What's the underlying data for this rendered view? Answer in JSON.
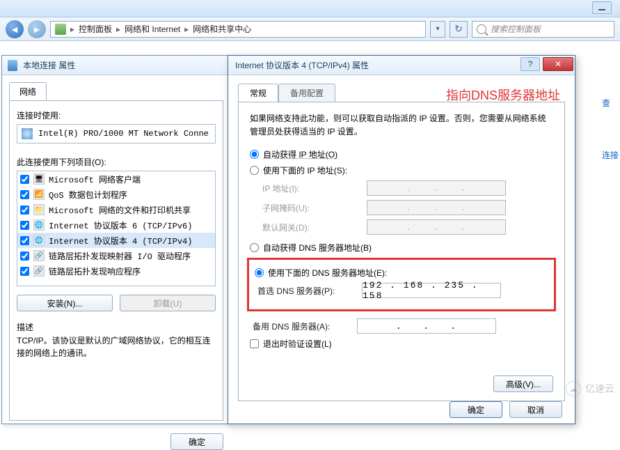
{
  "chrome": {
    "breadcrumbs": [
      "",
      "控制面板",
      "网络和 Internet",
      "网络和共享中心"
    ],
    "search_placeholder": "搜索控制面板"
  },
  "side_links": {
    "view": "查",
    "connect": "连接"
  },
  "dlg1": {
    "title": "本地连接 属性",
    "tab": "网络",
    "connect_label": "连接时使用:",
    "adapter": "Intel(R) PRO/1000 MT Network Conne",
    "items_label": "此连接使用下列项目(O):",
    "items": [
      {
        "label": "Microsoft 网络客户端",
        "checked": true
      },
      {
        "label": "QoS 数据包计划程序",
        "checked": true
      },
      {
        "label": "Microsoft 网络的文件和打印机共享",
        "checked": true
      },
      {
        "label": "Internet 协议版本 6 (TCP/IPv6)",
        "checked": true
      },
      {
        "label": "Internet 协议版本 4 (TCP/IPv4)",
        "checked": true,
        "selected": true
      },
      {
        "label": "链路层拓扑发现映射器 I/O 驱动程序",
        "checked": true
      },
      {
        "label": "链路层拓扑发现响应程序",
        "checked": true
      }
    ],
    "install": "安装(N)...",
    "uninstall": "卸载(U)",
    "desc_h": "描述",
    "desc_t": "TCP/IP。该协议是默认的广域网络协议，它的相互连接的网络上的通讯。",
    "ok": "确定"
  },
  "dlg2": {
    "title": "Internet 协议版本 4 (TCP/IPv4) 属性",
    "tabs": {
      "general": "常规",
      "alt": "备用配置"
    },
    "intro": "如果网络支持此功能，则可以获取自动指派的 IP 设置。否则，您需要从网络系统管理员处获得适当的 IP 设置。",
    "ip_auto": "自动获得 IP 地址(O)",
    "ip_manual": "使用下面的 IP 地址(S):",
    "ip_label": "IP 地址(I):",
    "mask_label": "子网掩码(U):",
    "gw_label": "默认网关(D):",
    "dns_auto": "自动获得 DNS 服务器地址(B)",
    "dns_manual": "使用下面的 DNS 服务器地址(E):",
    "dns_pref": "首选 DNS 服务器(P):",
    "dns_pref_val": "192 . 168 . 235 . 158",
    "dns_alt": "备用 DNS 服务器(A):",
    "validate": "退出时验证设置(L)",
    "advanced": "高级(V)...",
    "ok": "确定",
    "cancel": "取消",
    "annotation": "指向DNS服务器地址"
  },
  "watermark": "亿速云"
}
